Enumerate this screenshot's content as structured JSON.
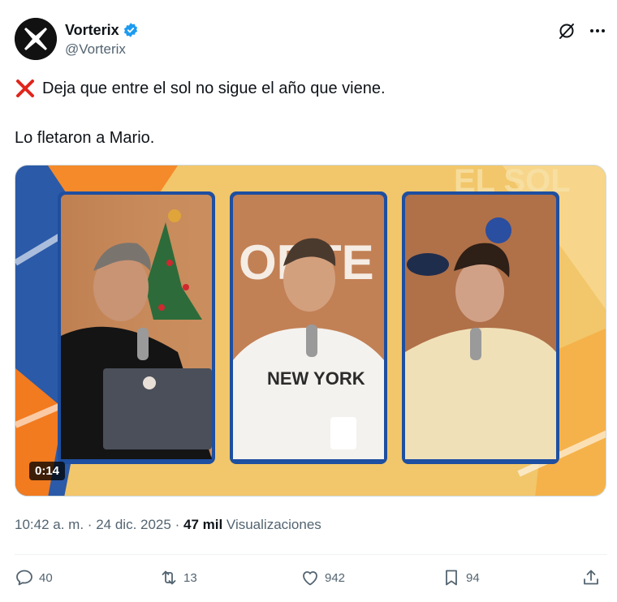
{
  "author": {
    "display_name": "Vorterix",
    "handle": "@Vorterix",
    "verified": true,
    "avatar_icon": "vorterix-x-logo"
  },
  "header_actions": {
    "grok_icon": "grok-icon",
    "more_icon": "more-icon"
  },
  "post": {
    "emoji": "cross-mark-icon",
    "line1": "Deja que entre el sol no sigue el año que viene.",
    "line2": "Lo fletaron a Mario."
  },
  "media": {
    "type": "video",
    "duration": "0:14",
    "shirt_text": "NEW YORK",
    "background_text": "EL SOL QUE"
  },
  "meta": {
    "time": "10:42 a. m.",
    "separator": "·",
    "date": "24 dic. 2025",
    "views_count": "47 mil",
    "views_label": "Visualizaciones"
  },
  "engagement": {
    "replies": "40",
    "reposts": "13",
    "likes": "942",
    "bookmarks": "94"
  },
  "colors": {
    "verified_blue": "#1d9bf0",
    "cross_red": "#e1251b",
    "secondary_text": "#536471",
    "primary_text": "#0f1419"
  }
}
